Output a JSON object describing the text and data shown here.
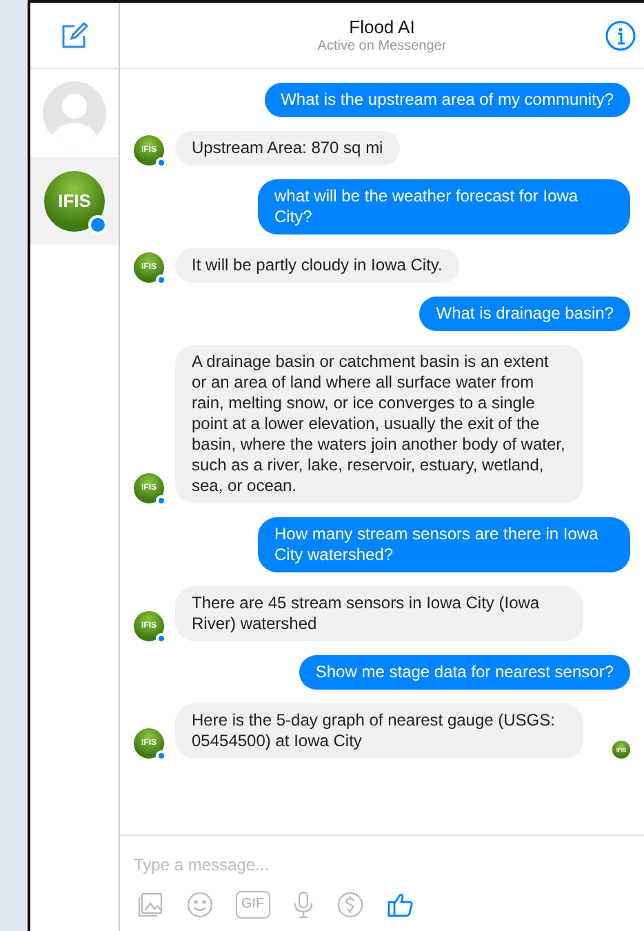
{
  "header": {
    "title": "Flood AI",
    "subtitle": "Active on Messenger"
  },
  "conversations": [
    {
      "kind": "placeholder",
      "selected": false
    },
    {
      "kind": "logo",
      "label": "IFIS",
      "selected": true
    }
  ],
  "messages": [
    {
      "kind": "user",
      "text": "What is the upstream area of my community?"
    },
    {
      "kind": "bot",
      "avatar": "IFIS",
      "text": "Upstream Area: 870 sq mi"
    },
    {
      "kind": "user",
      "text": "what will be the weather forecast for Iowa City?"
    },
    {
      "kind": "bot",
      "avatar": "IFIS",
      "text": "It will be partly cloudy in Iowa City."
    },
    {
      "kind": "user",
      "text": "What is drainage basin?"
    },
    {
      "kind": "bot",
      "avatar": "IFIS",
      "text": "A drainage basin or catchment basin is an extent or an area of land where all surface water from rain, melting snow, or ice converges to a single point at a lower elevation, usually the exit of the basin, where the waters join another body of water, such as a river, lake, reservoir, estuary, wetland, sea, or ocean."
    },
    {
      "kind": "user",
      "text": "How many stream sensors are there in Iowa City watershed?"
    },
    {
      "kind": "bot",
      "avatar": "IFIS",
      "text": "There are 45 stream sensors in Iowa City (Iowa River) watershed"
    },
    {
      "kind": "user",
      "text": "Show me stage data for nearest sensor?"
    },
    {
      "kind": "bot",
      "avatar": "IFIS",
      "text": "Here is the 5-day graph of nearest gauge (USGS: 05454500) at Iowa City",
      "read_receipt": "IFIS"
    }
  ],
  "composer": {
    "placeholder": "Type a message...",
    "gif_label": "GIF"
  }
}
